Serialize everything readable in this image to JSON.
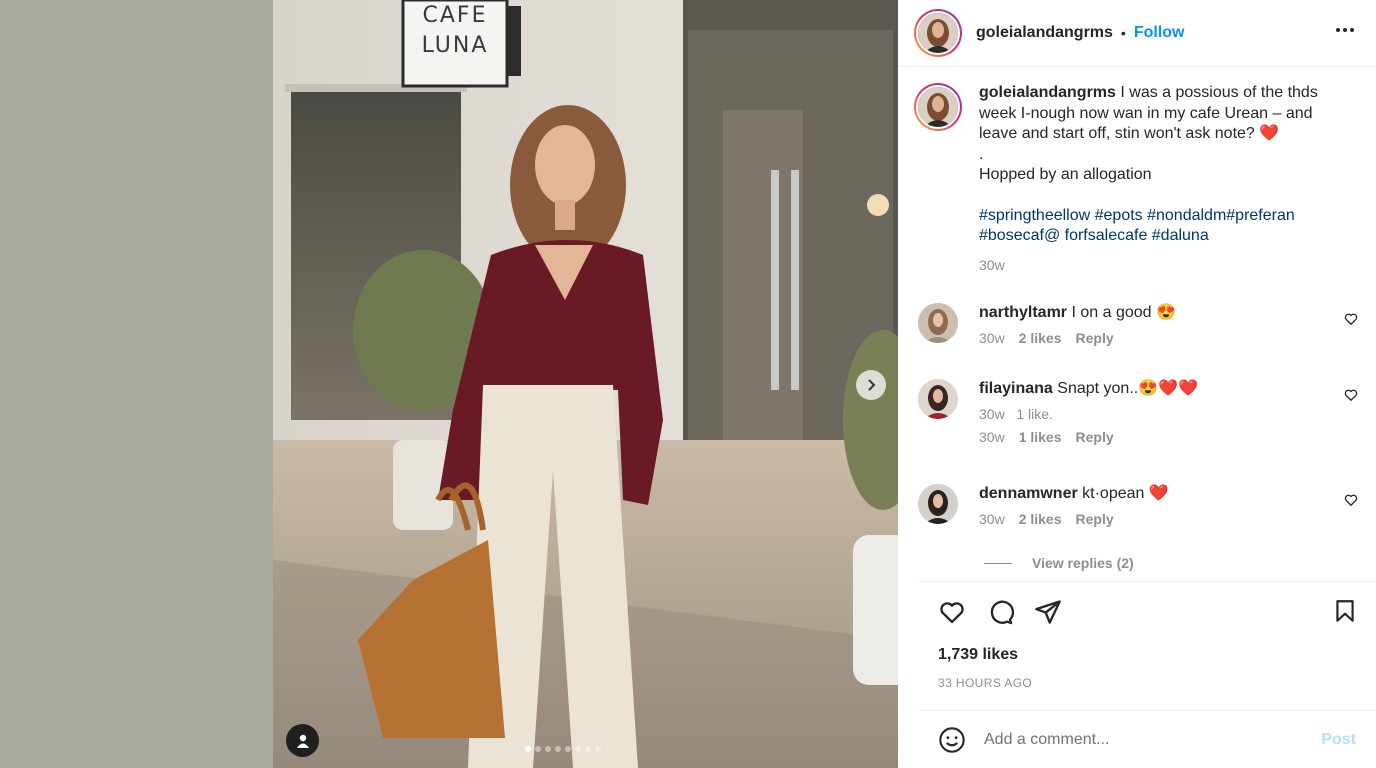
{
  "post": {
    "username": "goleialandangrms",
    "separator": "•",
    "follow_label": "Follow",
    "more_icon": "more-options-icon",
    "sign_text_line1": "CAFE",
    "sign_text_line2": "LUNA",
    "caption": {
      "username": "goleialandangrms",
      "text": "I was a possious of the thds week I-nough now wan in my cafe Urean – and leave and start off, stin won't ask note? ❤️",
      "dot": ".",
      "line2": "Hopped by an allogation",
      "hashtags": "#springtheellow #epots #nondaldm#preferan #bosecaf@ forfsalecafe #daluna",
      "time": "30w"
    },
    "comments": [
      {
        "username": "narthyltamr",
        "text": "I on a good 😍",
        "meta": [
          {
            "text": "30w"
          },
          {
            "text": "2 likes",
            "bold": true
          },
          {
            "text": "Reply",
            "bold": true
          }
        ]
      },
      {
        "username": "filayinana",
        "text": "Snapt yon..😍❤️❤️",
        "extra_line": "30w   1 like.",
        "meta": [
          {
            "text": "30w"
          },
          {
            "text": "1 likes",
            "bold": true
          },
          {
            "text": "Reply",
            "bold": true
          }
        ]
      },
      {
        "username": "dennamwner",
        "text": "kt·opean ❤️",
        "meta": [
          {
            "text": "30w"
          },
          {
            "text": "2 likes",
            "bold": true
          },
          {
            "text": "Reply",
            "bold": true
          }
        ]
      }
    ],
    "view_replies": "View replies (2)",
    "likes": "1,739 likes",
    "posted_ago": "33 HOURS AGO",
    "comment_placeholder": "Add a comment...",
    "post_label": "Post"
  },
  "carousel": {
    "count": 8,
    "active": 0
  },
  "colors": {
    "accent": "#0095f6",
    "hashtag": "#00376b",
    "muted": "#8e8e8e",
    "post_disabled": "#b2dffc"
  }
}
